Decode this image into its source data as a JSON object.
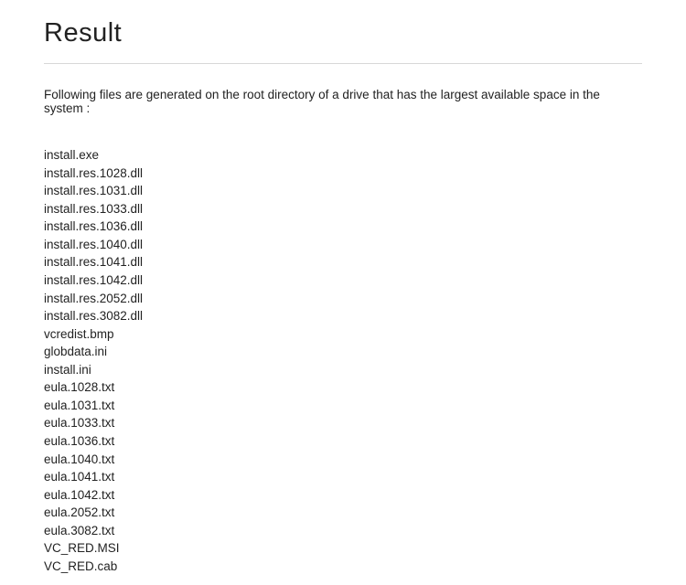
{
  "heading": "Result",
  "description": "Following files are generated on the root directory of a drive that has the largest available space in the system :",
  "files": [
    "install.exe",
    "install.res.1028.dll",
    "install.res.1031.dll",
    "install.res.1033.dll",
    "install.res.1036.dll",
    "install.res.1040.dll",
    "install.res.1041.dll",
    "install.res.1042.dll",
    "install.res.2052.dll",
    "install.res.3082.dll",
    "vcredist.bmp",
    "globdata.ini",
    "install.ini",
    "eula.1028.txt",
    "eula.1031.txt",
    "eula.1033.txt",
    "eula.1036.txt",
    "eula.1040.txt",
    "eula.1041.txt",
    "eula.1042.txt",
    "eula.2052.txt",
    "eula.3082.txt",
    "VC_RED.MSI",
    "VC_RED.cab"
  ]
}
